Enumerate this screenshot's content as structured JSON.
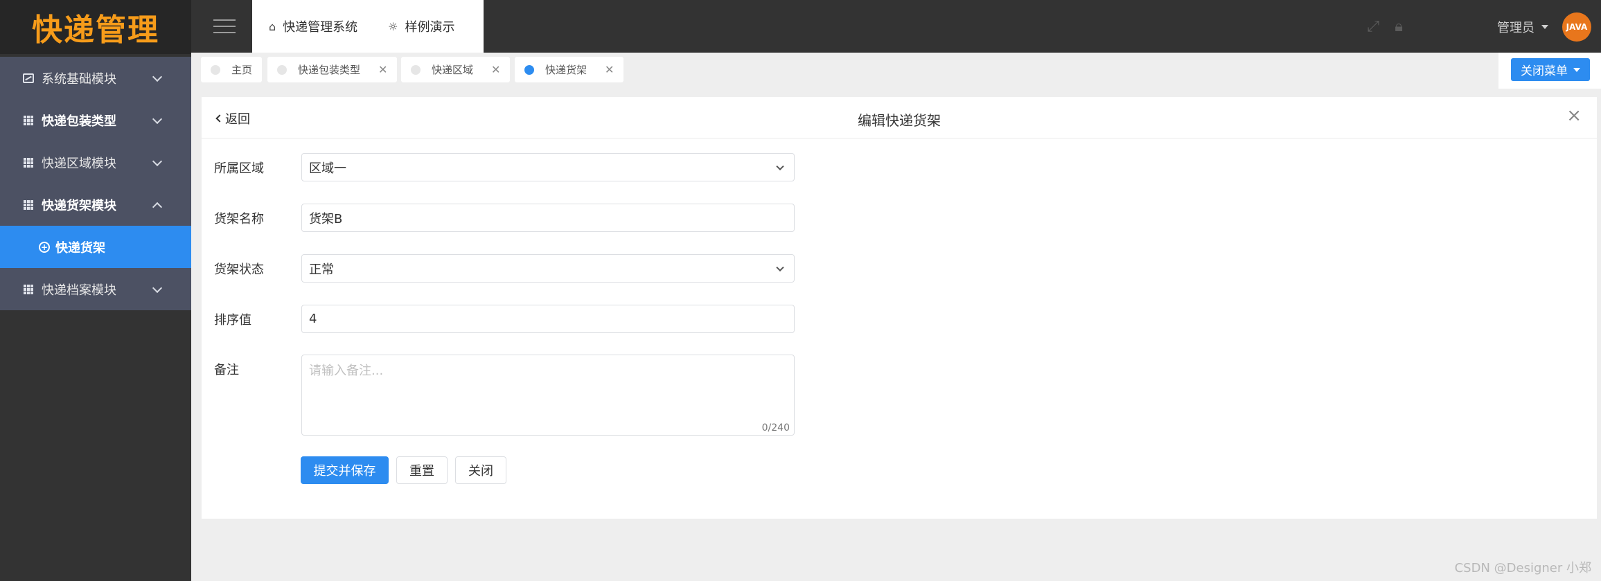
{
  "app": {
    "logo": "快递管理"
  },
  "sidebar": {
    "items": [
      {
        "label": "系统基础模块",
        "icon": "chart-icon",
        "expanded": false
      },
      {
        "label": "快递包装类型",
        "icon": "grid-icon",
        "expanded": false
      },
      {
        "label": "快递区域模块",
        "icon": "grid-icon",
        "expanded": false
      },
      {
        "label": "快递货架模块",
        "icon": "grid-icon",
        "expanded": true
      },
      {
        "label": "快递档案模块",
        "icon": "grid-icon",
        "expanded": false
      }
    ],
    "active_sub": {
      "label": "快递货架",
      "icon": "circle-plus-icon"
    }
  },
  "header": {
    "tabs": [
      {
        "label": "快递管理系统",
        "icon": "home-icon"
      },
      {
        "label": "样例演示",
        "icon": "bulb-icon"
      }
    ],
    "fullscreen_icon": "expand-icon",
    "lock_icon": "lock-icon",
    "user": "管理员",
    "avatar_text": "JAVA"
  },
  "tabstrip": {
    "tabs": [
      {
        "label": "主页",
        "closable": false,
        "active": false
      },
      {
        "label": "快递包装类型",
        "closable": true,
        "active": false
      },
      {
        "label": "快递区域",
        "closable": true,
        "active": false
      },
      {
        "label": "快递货架",
        "closable": true,
        "active": true
      }
    ],
    "close_menu": "关闭菜单"
  },
  "card": {
    "back": "返回",
    "title": "编辑快递货架",
    "close": "×"
  },
  "form": {
    "area": {
      "label": "所属区域",
      "value": "区域一"
    },
    "name": {
      "label": "货架名称",
      "value": "货架B"
    },
    "status": {
      "label": "货架状态",
      "value": "正常"
    },
    "sort": {
      "label": "排序值",
      "value": "4"
    },
    "remark": {
      "label": "备注",
      "placeholder": "请输入备注...",
      "counter": "0/240"
    }
  },
  "buttons": {
    "submit": "提交并保存",
    "reset": "重置",
    "close": "关闭"
  },
  "watermark": "CSDN @Designer 小郑",
  "colors": {
    "primary": "#2d8cf0",
    "sidebar": "#333333",
    "menu": "#4c5163",
    "logo": "#f79c1a"
  }
}
